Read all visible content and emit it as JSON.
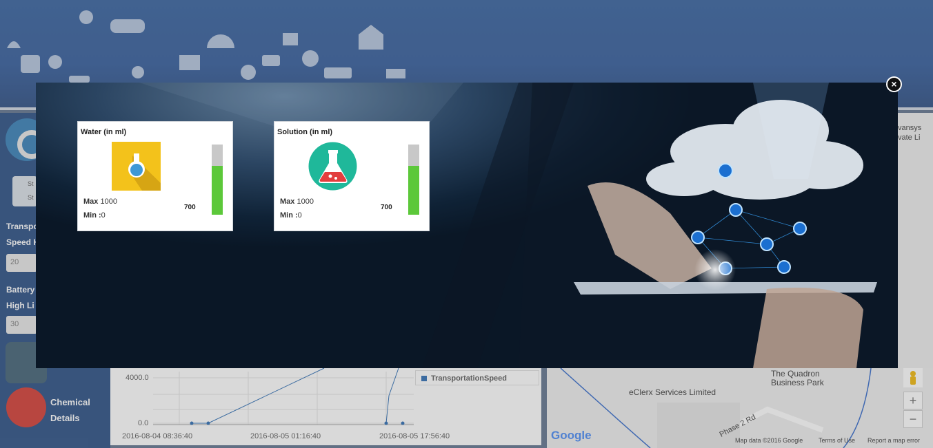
{
  "background": {
    "sidebar": {
      "transport_label": "Transpo",
      "speed_label": "Speed H",
      "speed_value": "20",
      "battery_label": "Battery",
      "high_label": "High Li",
      "battery_value": "30",
      "toggle_text_1": "St",
      "toggle_text_2": "St",
      "chemical_details": "Chemical Details"
    },
    "chart": {
      "y_labels": [
        "4000.0",
        "0.0"
      ],
      "x_labels": [
        "2016-08-04 08:36:40",
        "2016-08-05 01:16:40",
        "2016-08-05 17:56:40"
      ],
      "legend": "TransportationSpeed"
    },
    "right_text": [
      "vansys",
      "vate Li"
    ],
    "map": {
      "places": [
        "The Quadron",
        "Business Park",
        "eClerx Services Limited",
        "Phase 2 Rd"
      ],
      "footer": [
        "Map data ©2016 Google",
        "Terms of Use",
        "Report a map error"
      ],
      "zoom_in": "+",
      "zoom_out": "−",
      "google": "Google"
    }
  },
  "modal": {
    "close_label": "×",
    "cards": [
      {
        "title": "Water (in ml)",
        "icon": "flask-icon",
        "icon_bg": "#f3c21b",
        "max_label": "Max",
        "max_value": "1000",
        "min_label": "Min :",
        "min_value": "0",
        "current": "700",
        "level": 0.7
      },
      {
        "title": "Solution (in ml)",
        "icon": "beaker-icon",
        "icon_bg": "#1fb89a",
        "max_label": "Max",
        "max_value": "1000",
        "min_label": "Min :",
        "min_value": "0",
        "current": "700",
        "level": 0.7
      }
    ]
  },
  "colors": {
    "header_blue": "#2a5597",
    "gauge_fill": "#5cc83a",
    "gauge_empty": "#c8c8c8",
    "chart_line": "#2467b1"
  }
}
